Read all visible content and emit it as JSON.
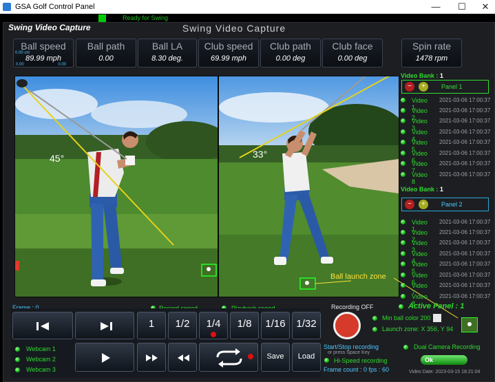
{
  "window": {
    "title": "GSA Golf Control Panel",
    "minimize_glyph": "—",
    "maximize_glyph": "☐",
    "close_glyph": "✕"
  },
  "status": {
    "text": "Ready for Swing",
    "color": "#1cc21c"
  },
  "header": {
    "left_title": "Swing Video Capture",
    "center_title": "Swing Video Capture"
  },
  "stats": [
    {
      "label": "Ball speed",
      "value": "89.99 mph"
    },
    {
      "label": "Ball path",
      "value": "0.00"
    },
    {
      "label": "Ball LA",
      "value": "8.30 deg."
    },
    {
      "label": "Club speed",
      "value": "69.99 mph"
    },
    {
      "label": "Club path",
      "value": "0.00 deg"
    },
    {
      "label": "Club face",
      "value": "0.00 deg"
    },
    {
      "label": "Spin rate",
      "value": "1478 rpm"
    }
  ],
  "ball_speed_mini": {
    "top": "0.00 cm",
    "bl": "0.00",
    "br": "0.00"
  },
  "video_left": {
    "angle": "45°"
  },
  "video_right": {
    "angle": "33°",
    "launch_zone_label": "Ball launch zone"
  },
  "banks": [
    {
      "header_label": "Video Bank :",
      "header_value": "1",
      "panel_label": "Panel 1",
      "minus_glyph": "−",
      "plus_glyph": "+",
      "videos": [
        {
          "name": "Video 1",
          "date": "2021-03-06 17:00:37"
        },
        {
          "name": "Video 2",
          "date": "2021-03-06 17:00:37"
        },
        {
          "name": "Video 3",
          "date": "2021-03-06 17:00:37"
        },
        {
          "name": "Video 4",
          "date": "2021-03-06 17:00:37"
        },
        {
          "name": "Video 5",
          "date": "2021-03-06 17:00:37"
        },
        {
          "name": "Video 6",
          "date": "2021-03-06 17:00:37"
        },
        {
          "name": "Video 7",
          "date": "2021-03-06 17:00:37"
        },
        {
          "name": "Video 8",
          "date": "2021-03-06 17:00:37"
        }
      ]
    },
    {
      "header_label": "Video Bank :",
      "header_value": "1",
      "panel_label": "Panel 2",
      "minus_glyph": "−",
      "plus_glyph": "+",
      "videos": [
        {
          "name": "Video 1",
          "date": "2021-03-06 17:00:37"
        },
        {
          "name": "Video 2",
          "date": "2021-03-06 17:00:37"
        },
        {
          "name": "Video 3",
          "date": "2021-03-06 17:00:37"
        },
        {
          "name": "Video 4",
          "date": "2021-03-06 17:00:37"
        },
        {
          "name": "Video 5",
          "date": "2021-03-06 17:00:37"
        },
        {
          "name": "Video 6",
          "date": "2021-03-06 17:00:37"
        },
        {
          "name": "Video 7",
          "date": "2021-03-06 17:00:37"
        },
        {
          "name": "Video 8",
          "date": "2021-03-06 17:00:37"
        }
      ]
    }
  ],
  "controls": {
    "frame_label": "Frame : 0",
    "record_speed_label": "Record speed",
    "playback_speed_label": "Playback speed",
    "speeds": [
      "1",
      "1/2",
      "1/4",
      "1/8",
      "1/16",
      "1/32"
    ],
    "save_label": "Save",
    "load_label": "Load",
    "webcams": [
      "Webcam 1",
      "Webcam 2",
      "Webcam 3"
    ]
  },
  "recording": {
    "status": "Recording OFF",
    "start_stop": "Start/Stop recording",
    "press_space": "or press Space Key",
    "hi_speed": "Hi-Speed recording",
    "frame_count": "Frame count : 0 fps : 60",
    "active_panel": "Active Panel : 1",
    "min_ball_color": "Min ball color 200",
    "launch_zone": "Launch zone: X 356, Y 94",
    "dual_camera": "Dual Camera Recording",
    "ok_label": "Ok",
    "video_date": "Video Date: 2023-03-15 18:21:04"
  },
  "colors": {
    "accent_green": "#2edc2e",
    "accent_blue": "#2ba8d8",
    "yellow_line": "#e6d21a",
    "record_red": "#d53a2a"
  }
}
